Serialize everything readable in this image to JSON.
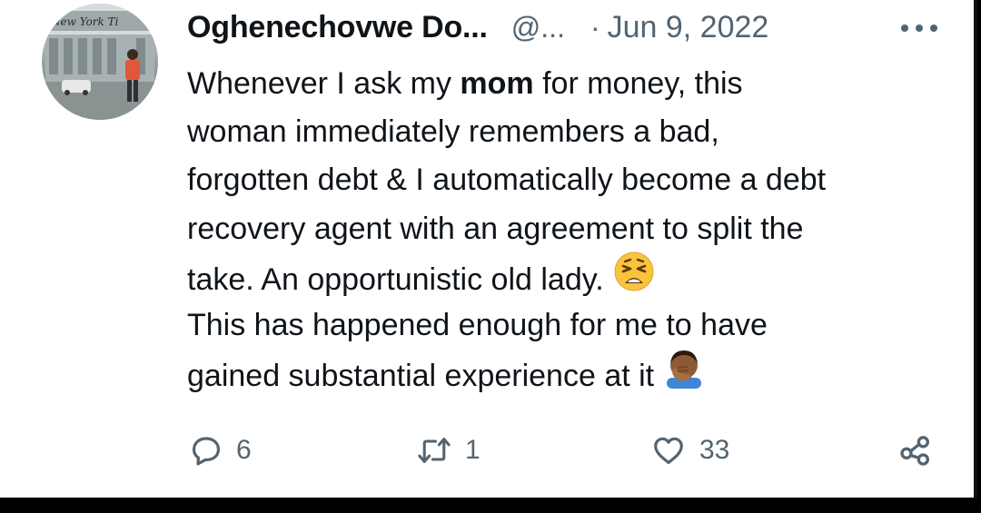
{
  "tweet": {
    "author_name": "Oghenechovwe Do...",
    "handle": "@...",
    "separator": "·",
    "date": "Jun 9, 2022",
    "lines": [
      {
        "pre": "Whenever I ask my ",
        "bold": "mom",
        "post": " for money, this"
      },
      {
        "text": "woman immediately remembers a bad,"
      },
      {
        "text": "forgotten debt & I automatically become a debt"
      },
      {
        "text": "recovery agent with an agreement to split the"
      },
      {
        "text": "take. An opportunistic old lady.",
        "emoji": "weary-face-emoji"
      },
      {
        "text": "This has happened enough for me to have"
      },
      {
        "text": "gained substantial experience at it",
        "emoji": "facepalm-emoji"
      }
    ],
    "avatar_sign_text": "New York Ti"
  },
  "actions": {
    "reply": {
      "icon": "reply-icon",
      "count": "6"
    },
    "retweet": {
      "icon": "retweet-icon",
      "count": "1"
    },
    "like": {
      "icon": "heart-icon",
      "count": "33"
    },
    "share": {
      "icon": "share-icon"
    }
  },
  "colors": {
    "text": "#0f1419",
    "secondary": "#536471",
    "background": "#ffffff"
  }
}
